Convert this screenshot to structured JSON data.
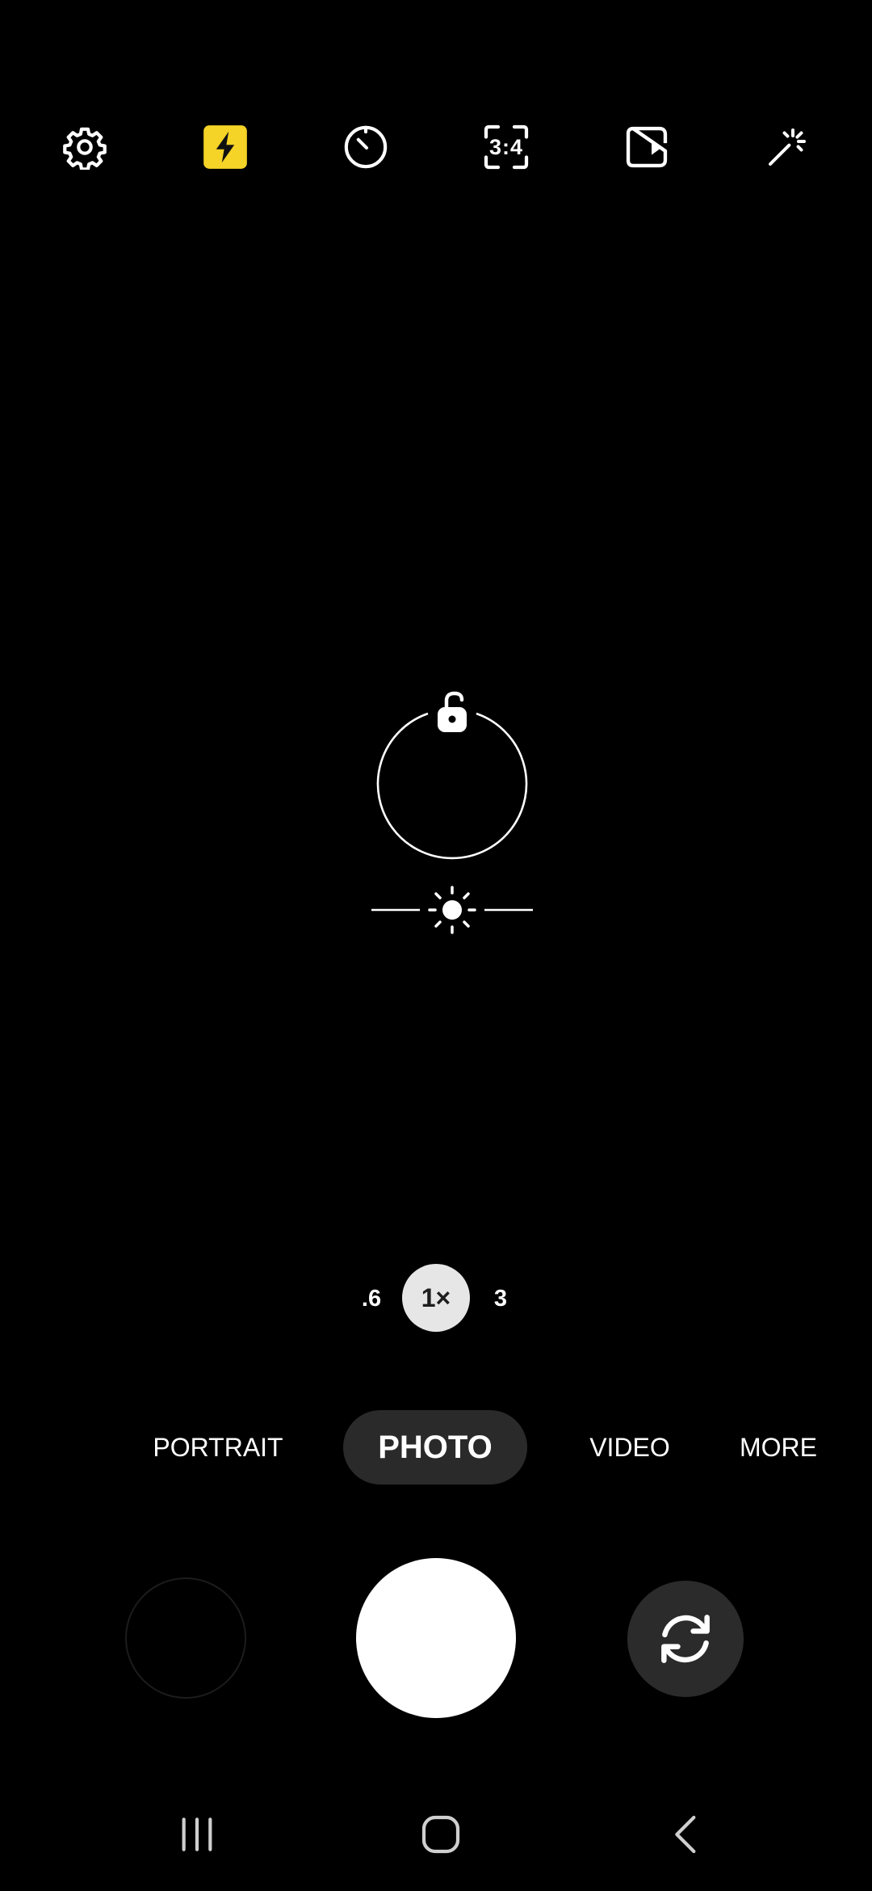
{
  "top_bar": {
    "items": [
      {
        "name": "settings",
        "icon": "gear-icon"
      },
      {
        "name": "flash",
        "icon": "flash-icon",
        "state": "on",
        "accent": "#f5d327"
      },
      {
        "name": "timer",
        "icon": "timer-icon"
      },
      {
        "name": "aspect-ratio",
        "icon": "aspect-ratio-icon",
        "label": "3:4"
      },
      {
        "name": "motion-photo",
        "icon": "motion-photo-icon"
      },
      {
        "name": "effects",
        "icon": "magic-wand-icon"
      }
    ]
  },
  "focus": {
    "lock_icon": "unlocked-padlock-icon",
    "exposure_icon": "sun-icon"
  },
  "zoom": {
    "options": [
      ".6",
      "1×",
      "3"
    ],
    "selected": "1×"
  },
  "modes": {
    "items": [
      "PORTRAIT",
      "PHOTO",
      "VIDEO",
      "MORE"
    ],
    "selected": "PHOTO"
  },
  "capture": {
    "gallery_icon": "gallery-thumbnail",
    "shutter_icon": "shutter-button",
    "switch_icon": "switch-camera-icon"
  },
  "nav": {
    "items": [
      {
        "name": "recents",
        "icon": "recents-icon"
      },
      {
        "name": "home",
        "icon": "home-icon"
      },
      {
        "name": "back",
        "icon": "back-icon"
      }
    ]
  },
  "colors": {
    "background": "#000000",
    "flash_accent": "#f5d327",
    "mode_pill": "#2a2a2a",
    "zoom_active_bg": "#e6e6e6"
  }
}
